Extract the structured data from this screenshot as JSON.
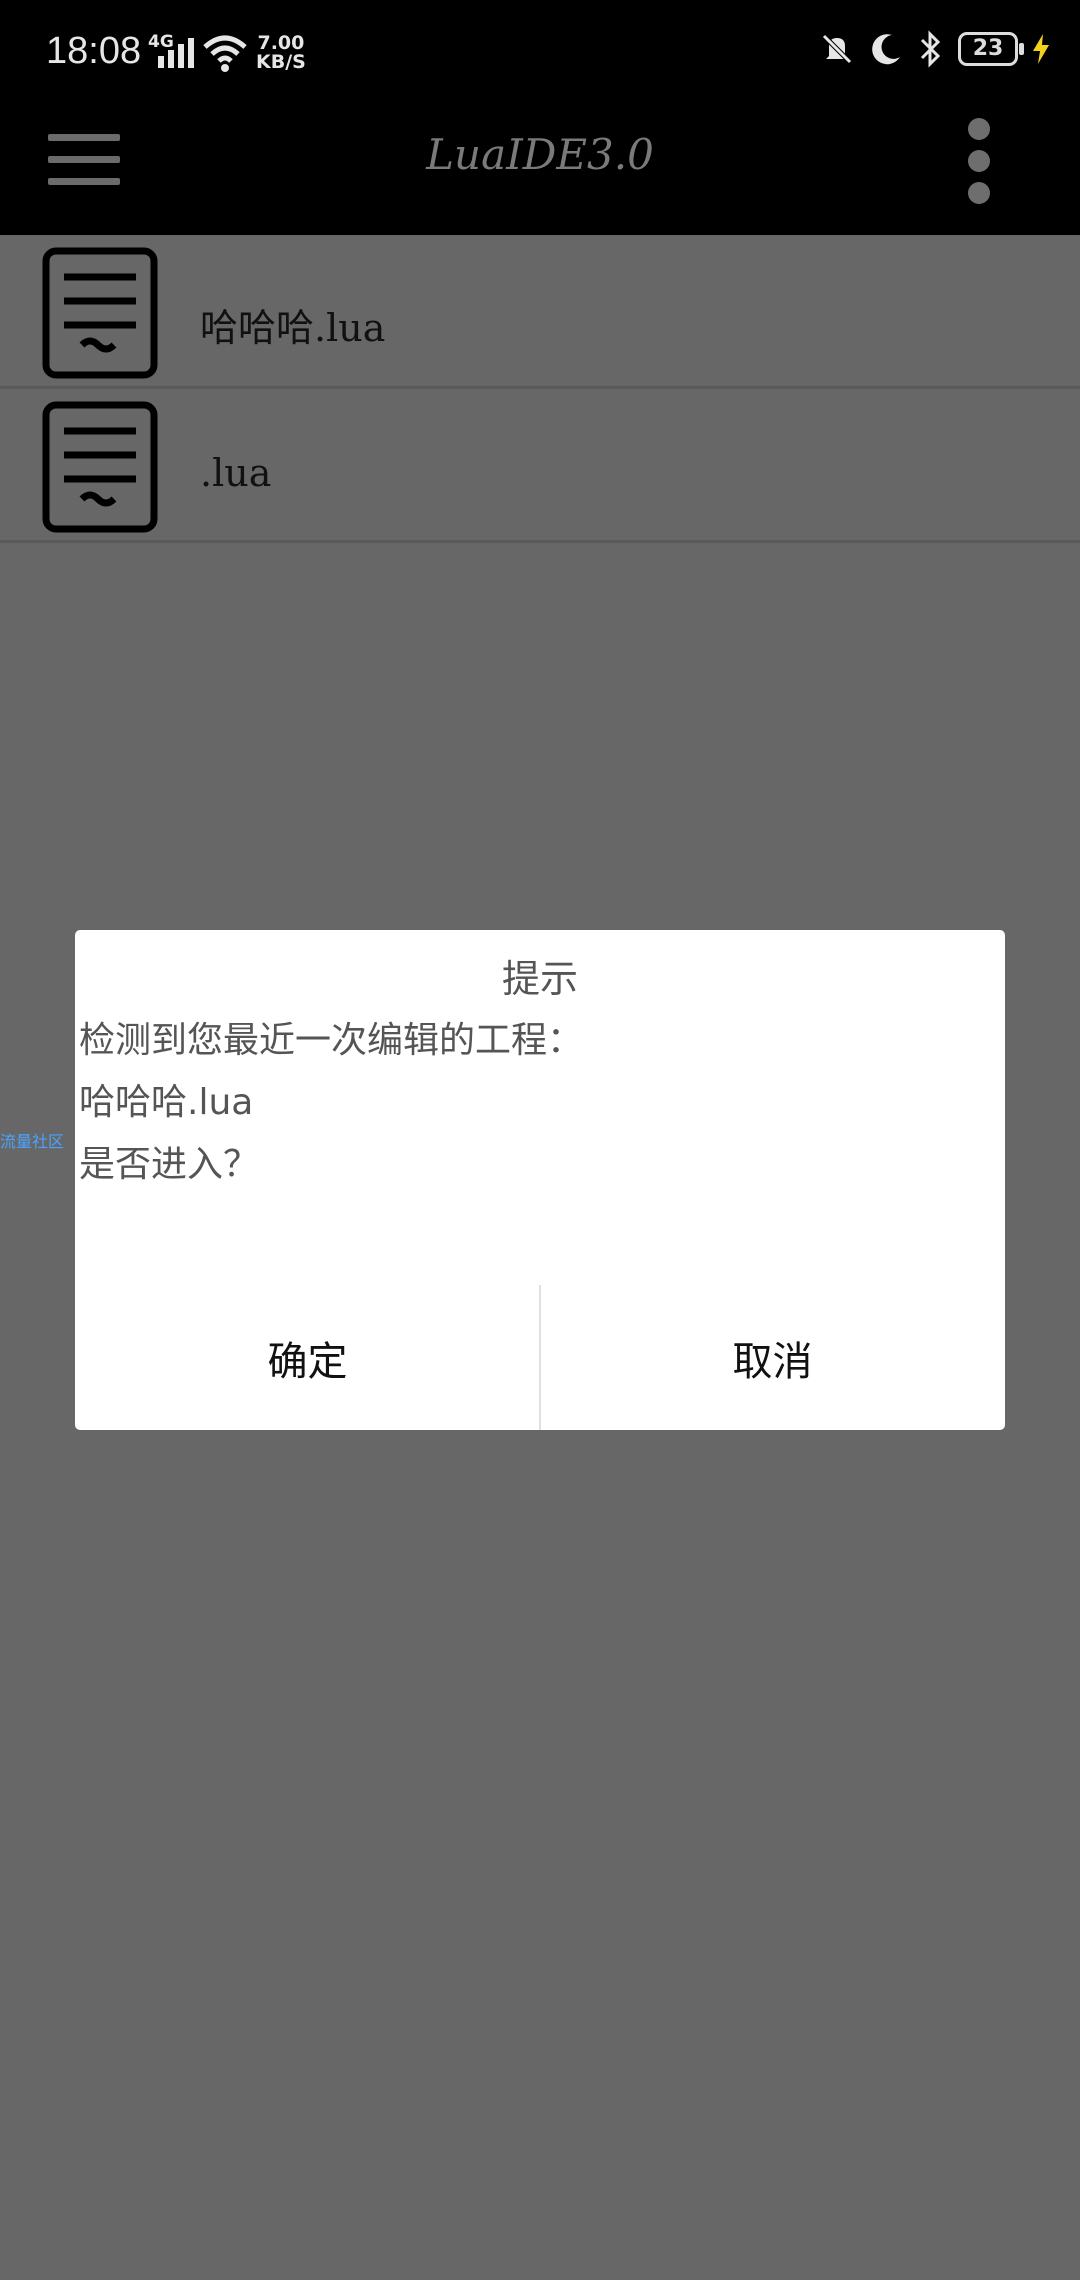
{
  "status_bar": {
    "time": "18:08",
    "network": "4G",
    "speed_value": "7.00",
    "speed_unit": "KB/S",
    "battery": "23"
  },
  "toolbar": {
    "title": "LuaIDE3.0"
  },
  "files": [
    {
      "name": "哈哈哈.lua"
    },
    {
      "name": ".lua"
    }
  ],
  "side_tab": {
    "label": "流量社区"
  },
  "dialog": {
    "title": "提示",
    "message": "检测到您最近一次编辑的工程：\n哈哈哈.lua\n是否进入？",
    "confirm_label": "确定",
    "cancel_label": "取消"
  },
  "colors": {
    "overlay": "#676767",
    "bar": "#000000",
    "dialog_bg": "#ffffff",
    "accent": "#4aa3ff"
  }
}
